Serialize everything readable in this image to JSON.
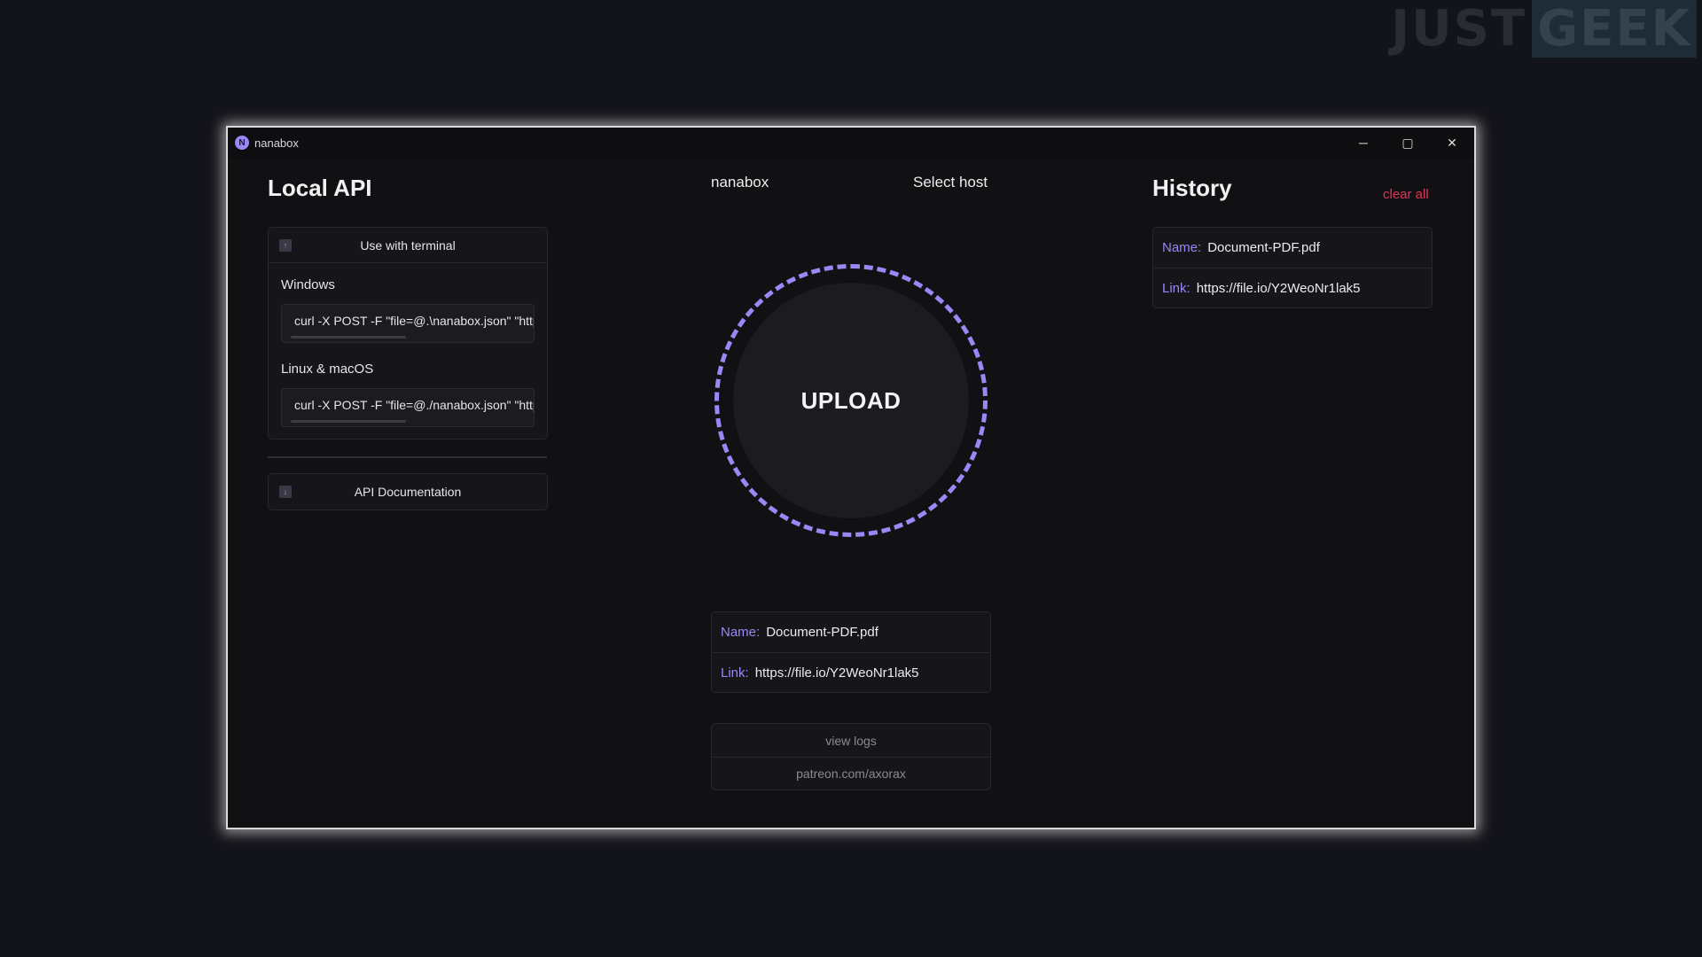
{
  "watermark": {
    "just": "JUST",
    "geek": "GEEK"
  },
  "window": {
    "title": "nanabox",
    "logo_letter": "N",
    "minimize": "─",
    "maximize": "▢",
    "close": "✕"
  },
  "local_api": {
    "title": "Local API",
    "terminal_section": {
      "label": "Use with terminal",
      "icon": "↑",
      "windows_label": "Windows",
      "windows_cmd": "curl -X POST -F \"file=@.\\nanabox.json\" \"https://file.io\"",
      "linux_label": "Linux & macOS",
      "linux_cmd": "curl -X POST -F \"file=@./nanabox.json\" \"https://file.io\""
    },
    "docs_section": {
      "label": "API Documentation",
      "icon": "↓"
    }
  },
  "center": {
    "app_link": "nanabox",
    "select_host": "Select host",
    "upload_label": "UPLOAD",
    "result": {
      "name_key": "Name:",
      "name_value": "Document-PDF.pdf",
      "link_key": "Link:",
      "link_value": "https://file.io/Y2WeoNr1lak5"
    },
    "footer": {
      "view_logs": "view logs",
      "patreon": "patreon.com/axorax"
    }
  },
  "history": {
    "title": "History",
    "clear_all": "clear all",
    "items": [
      {
        "name_key": "Name:",
        "name_value": "Document-PDF.pdf",
        "link_key": "Link:",
        "link_value": "https://file.io/Y2WeoNr1lak5"
      }
    ]
  },
  "colors": {
    "accent": "#9b87f5",
    "danger": "#e0365a",
    "background": "#111113"
  }
}
